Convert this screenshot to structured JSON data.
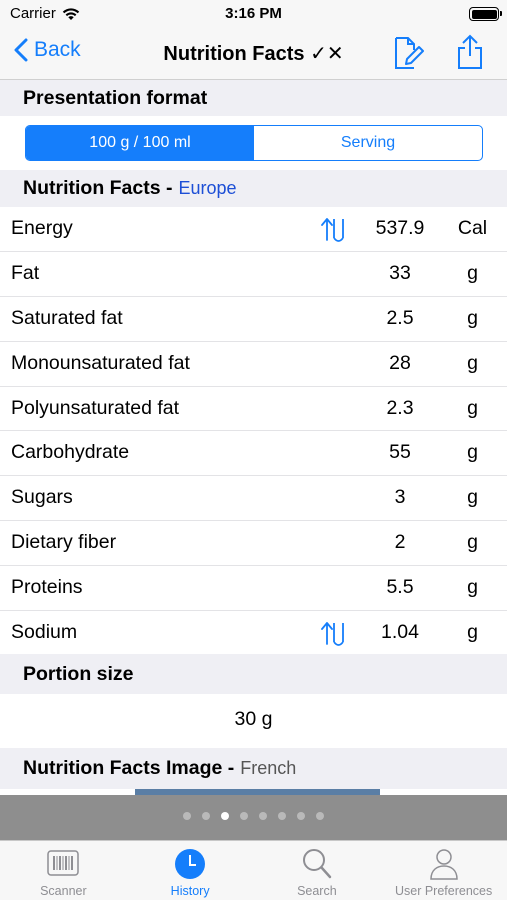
{
  "status": {
    "carrier": "Carrier",
    "time": "3:16 PM"
  },
  "nav": {
    "back_label": "Back",
    "title": "Nutrition Facts ✓✕"
  },
  "presentation": {
    "header": "Presentation format",
    "options": [
      "100 g / 100 ml",
      "Serving"
    ],
    "selected": "100 g / 100 ml"
  },
  "nutrition": {
    "header": "Nutrition Facts -",
    "region": "Europe",
    "rows": [
      {
        "name": "Energy",
        "value": "537.9",
        "unit": "Cal",
        "swap_icon": true
      },
      {
        "name": "Fat",
        "value": "33",
        "unit": "g",
        "swap_icon": false
      },
      {
        "name": "Saturated fat",
        "value": "2.5",
        "unit": "g",
        "swap_icon": false
      },
      {
        "name": "Monounsaturated fat",
        "value": "28",
        "unit": "g",
        "swap_icon": false
      },
      {
        "name": "Polyunsaturated fat",
        "value": "2.3",
        "unit": "g",
        "swap_icon": false
      },
      {
        "name": "Carbohydrate",
        "value": "55",
        "unit": "g",
        "swap_icon": false
      },
      {
        "name": "Sugars",
        "value": "3",
        "unit": "g",
        "swap_icon": false
      },
      {
        "name": "Dietary fiber",
        "value": "2",
        "unit": "g",
        "swap_icon": false
      },
      {
        "name": "Proteins",
        "value": "5.5",
        "unit": "g",
        "swap_icon": false
      },
      {
        "name": "Sodium",
        "value": "1.04",
        "unit": "g",
        "swap_icon": true
      }
    ]
  },
  "portion": {
    "header": "Portion size",
    "value": "30 g"
  },
  "image_section": {
    "header": "Nutrition Facts Image -",
    "language": "French"
  },
  "pager": {
    "count": 8,
    "current": 3
  },
  "tabs": [
    {
      "label": "Scanner",
      "icon": "barcode-icon",
      "active": false
    },
    {
      "label": "History",
      "icon": "clock-icon",
      "active": true
    },
    {
      "label": "Search",
      "icon": "search-icon",
      "active": false
    },
    {
      "label": "User Preferences",
      "icon": "person-icon",
      "active": false
    }
  ],
  "colors": {
    "accent": "#157efb",
    "region_link": "#1d4fd6",
    "group_background": "#efeff4",
    "pager_background": "#8e8e8e"
  }
}
